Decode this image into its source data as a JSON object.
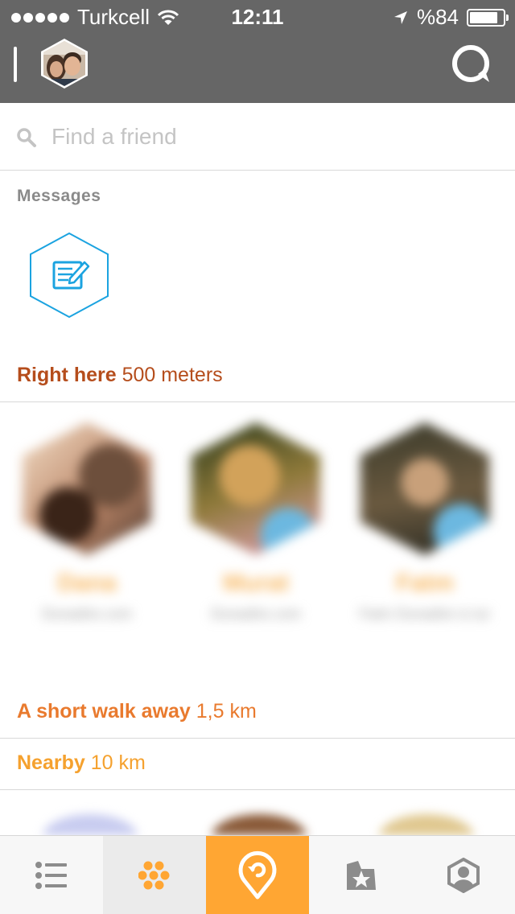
{
  "status_bar": {
    "carrier": "Turkcell",
    "time": "12:11",
    "battery": "%84",
    "battery_level": 0.84,
    "icons": [
      "signal-dots-icon",
      "wifi-icon",
      "location-arrow-icon",
      "battery-icon"
    ]
  },
  "header": {
    "icons": [
      "menu-icon",
      "profile-avatar",
      "search-bubble-icon"
    ]
  },
  "search": {
    "placeholder": "Find a friend",
    "value": ""
  },
  "messages": {
    "heading": "Messages",
    "icon": "compose-message-icon"
  },
  "sections": {
    "right_here": {
      "label": "Right here",
      "distance": "500 meters",
      "color": "#b54d1c"
    },
    "short_walk": {
      "label": "A short walk away",
      "distance": "1,5 km",
      "color": "#e97a2e"
    },
    "nearby": {
      "label": "Nearby",
      "distance": "10 km",
      "color": "#f5a12e"
    }
  },
  "friends": [
    {
      "name": "Dana",
      "detail": "Dunadire.com"
    },
    {
      "name": "Murat",
      "detail": "Dunadire.com"
    },
    {
      "name": "Fatm",
      "detail": "Fatm Dunadire is tur"
    }
  ],
  "tabbar": {
    "tabs": [
      {
        "icon": "list-icon",
        "selected": false
      },
      {
        "icon": "honeycomb-icon",
        "selected": true
      },
      {
        "icon": "checkin-icon",
        "selected": false
      },
      {
        "icon": "star-badge-icon",
        "selected": false
      },
      {
        "icon": "profile-icon",
        "selected": false
      }
    ]
  },
  "colors": {
    "header_bg": "#666666",
    "accent_orange": "#ffa633",
    "compose_blue": "#1ba3e0"
  }
}
